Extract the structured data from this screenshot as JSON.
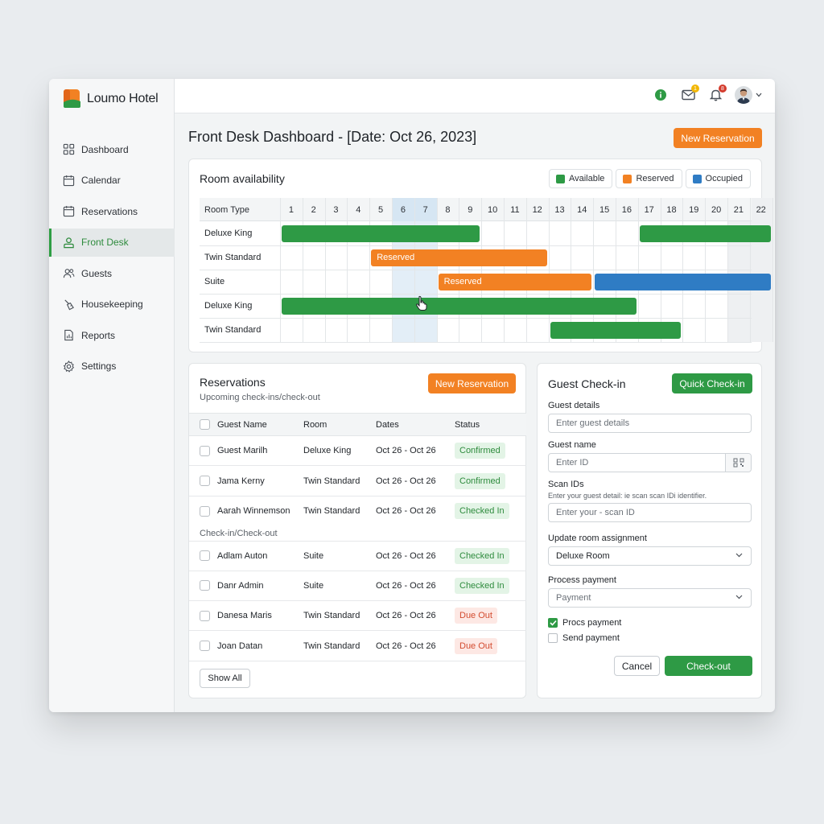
{
  "brand": {
    "name": "Loumo Hotel"
  },
  "nav": [
    {
      "label": "Dashboard",
      "icon": "dashboard-icon",
      "active": false
    },
    {
      "label": "Calendar",
      "icon": "calendar-icon",
      "active": false
    },
    {
      "label": "Reservations",
      "icon": "reservations-icon",
      "active": false
    },
    {
      "label": "Front Desk",
      "icon": "front-desk-icon",
      "active": true
    },
    {
      "label": "Guests",
      "icon": "guests-icon",
      "active": false
    },
    {
      "label": "Housekeeping",
      "icon": "housekeeping-icon",
      "active": false
    },
    {
      "label": "Reports",
      "icon": "reports-icon",
      "active": false
    },
    {
      "label": "Settings",
      "icon": "settings-icon",
      "active": false
    }
  ],
  "topbar": {
    "mail_badge": "1",
    "bell_badge": "8"
  },
  "page": {
    "title": "Front Desk Dashboard - [Date: Oct 26, 2023]",
    "new_reservation": "New Reservation"
  },
  "availability": {
    "title": "Room availability",
    "legend": [
      {
        "label": "Available",
        "color": "#2e9a45"
      },
      {
        "label": "Reserved",
        "color": "#f28123"
      },
      {
        "label": "Occupied",
        "color": "#2f7cc4"
      }
    ],
    "header": "Room Type",
    "days": [
      "1",
      "2",
      "3",
      "4",
      "5",
      "6",
      "7",
      "8",
      "9",
      "10",
      "11",
      "12",
      "13",
      "14",
      "15",
      "16",
      "17",
      "18",
      "19",
      "20",
      "21",
      "22"
    ],
    "highlight_days": [
      6,
      7
    ],
    "shaded_days": [
      21,
      22
    ],
    "rows": [
      {
        "room": "Deluxe King",
        "bars": [
          {
            "start": 1,
            "end": 9,
            "status": "available",
            "label": ""
          },
          {
            "start": 17,
            "end": 22,
            "status": "available",
            "label": ""
          }
        ]
      },
      {
        "room": "Twin Standard",
        "bars": [
          {
            "start": 5,
            "end": 12,
            "status": "reserved",
            "label": "Reserved"
          }
        ]
      },
      {
        "room": "Suite",
        "bars": [
          {
            "start": 8,
            "end": 14,
            "status": "reserved",
            "label": "Reserved"
          },
          {
            "start": 15,
            "end": 22,
            "status": "occupied",
            "label": ""
          }
        ]
      },
      {
        "room": "Deluxe King",
        "bars": [
          {
            "start": 1,
            "end": 16,
            "status": "available",
            "label": ""
          }
        ]
      },
      {
        "room": "Twin Standard",
        "bars": [
          {
            "start": 13,
            "end": 18,
            "status": "available",
            "label": ""
          }
        ]
      }
    ]
  },
  "reservations": {
    "title": "Reservations",
    "subtitle": "Upcoming check-ins/check-out",
    "button": "New Reservation",
    "columns": [
      "Guest Name",
      "Room",
      "Dates",
      "Status"
    ],
    "section_label": "Check-in/Check-out",
    "rows": [
      {
        "name": "Guest Marilh",
        "room": "Deluxe King",
        "dates": "Oct 26 - Oct 26",
        "status": "Confirmed",
        "tone": "green"
      },
      {
        "name": "Jama Kerny",
        "room": "Twin Standard",
        "dates": "Oct 26 - Oct 26",
        "status": "Confirmed",
        "tone": "green"
      },
      {
        "name": "Aarah Winnemson",
        "room": "Twin Standard",
        "dates": "Oct 26 - Oct 26",
        "status": "Checked In",
        "tone": "green"
      },
      {
        "name": "Adlam Auton",
        "room": "Suite",
        "dates": "Oct 26 - Oct 26",
        "status": "Checked In",
        "tone": "green"
      },
      {
        "name": "Danr Admin",
        "room": "Suite",
        "dates": "Oct 26 - Oct 26",
        "status": "Checked In",
        "tone": "green"
      },
      {
        "name": "Danesa Maris",
        "room": "Twin Standard",
        "dates": "Oct 26 - Oct 26",
        "status": "Due Out",
        "tone": "red"
      },
      {
        "name": "Joan Datan",
        "room": "Twin Standard",
        "dates": "Oct 26 - Oct 26",
        "status": "Due Out",
        "tone": "red"
      }
    ],
    "show_all": "Show All"
  },
  "checkin": {
    "title": "Guest Check-in",
    "quick_button": "Quick Check-in",
    "guest_details_label": "Guest details",
    "guest_details_placeholder": "Enter guest details",
    "guest_name_label": "Guest name",
    "guest_name_placeholder": "Enter ID",
    "scan_label": "Scan IDs",
    "scan_help": "Enter your guest detail: ie scan scan IDi identifier.",
    "scan_placeholder": "Enter your - scan ID",
    "room_label": "Update room assignment",
    "room_value": "Deluxe Room",
    "payment_label": "Process payment",
    "payment_value": "Payment",
    "check1": {
      "label": "Procs payment",
      "checked": true
    },
    "check2": {
      "label": "Send payment",
      "checked": false
    },
    "cancel": "Cancel",
    "checkout": "Check-out"
  }
}
